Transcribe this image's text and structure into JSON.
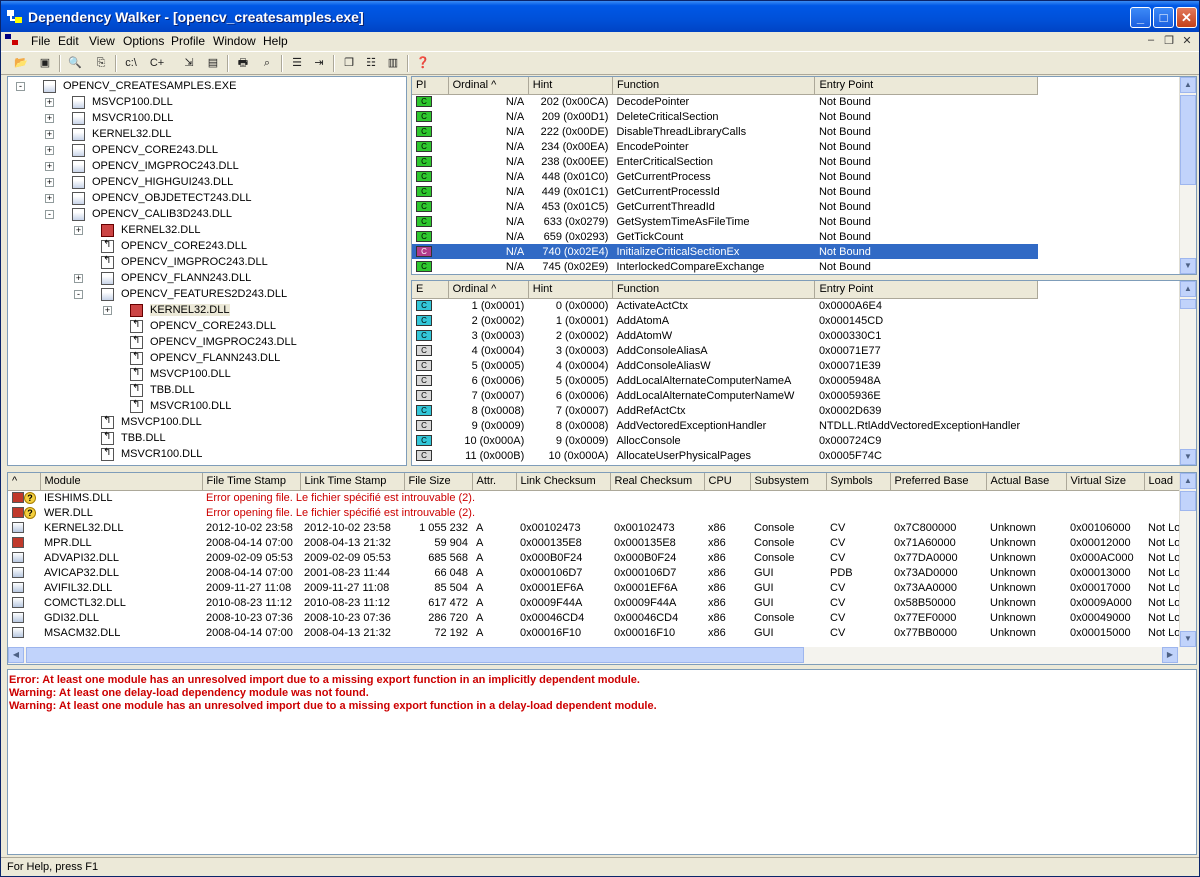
{
  "window": {
    "title": "Dependency Walker - [opencv_createsamples.exe]"
  },
  "menu": [
    "File",
    "Edit",
    "View",
    "Options",
    "Profile",
    "Window",
    "Help"
  ],
  "colors": {
    "titlebar": "#0054e3",
    "selection": "#316ac5",
    "error": "#cc0000",
    "import_ok": "#2ec72e",
    "export": "#33c7d9"
  },
  "tree": [
    {
      "label": "OPENCV_CREATESAMPLES.EXE",
      "depth": 0,
      "icon": "exe",
      "exp": "-"
    },
    {
      "label": "MSVCP100.DLL",
      "depth": 1,
      "icon": "dll",
      "exp": "+"
    },
    {
      "label": "MSVCR100.DLL",
      "depth": 1,
      "icon": "dll",
      "exp": "+"
    },
    {
      "label": "KERNEL32.DLL",
      "depth": 1,
      "icon": "dll",
      "exp": "+"
    },
    {
      "label": "OPENCV_CORE243.DLL",
      "depth": 1,
      "icon": "dll",
      "exp": "+"
    },
    {
      "label": "OPENCV_IMGPROC243.DLL",
      "depth": 1,
      "icon": "dll",
      "exp": "+"
    },
    {
      "label": "OPENCV_HIGHGUI243.DLL",
      "depth": 1,
      "icon": "dll",
      "exp": "+"
    },
    {
      "label": "OPENCV_OBJDETECT243.DLL",
      "depth": 1,
      "icon": "dll",
      "exp": "+"
    },
    {
      "label": "OPENCV_CALIB3D243.DLL",
      "depth": 1,
      "icon": "dll",
      "exp": "-"
    },
    {
      "label": "KERNEL32.DLL",
      "depth": 2,
      "icon": "red",
      "exp": "+"
    },
    {
      "label": "OPENCV_CORE243.DLL",
      "depth": 2,
      "icon": "arrow",
      "exp": ""
    },
    {
      "label": "OPENCV_IMGPROC243.DLL",
      "depth": 2,
      "icon": "arrow",
      "exp": ""
    },
    {
      "label": "OPENCV_FLANN243.DLL",
      "depth": 2,
      "icon": "dll",
      "exp": "+"
    },
    {
      "label": "OPENCV_FEATURES2D243.DLL",
      "depth": 2,
      "icon": "dll",
      "exp": "-"
    },
    {
      "label": "KERNEL32.DLL",
      "depth": 3,
      "icon": "red",
      "exp": "+",
      "sel": true
    },
    {
      "label": "OPENCV_CORE243.DLL",
      "depth": 3,
      "icon": "arrow",
      "exp": ""
    },
    {
      "label": "OPENCV_IMGPROC243.DLL",
      "depth": 3,
      "icon": "arrow",
      "exp": ""
    },
    {
      "label": "OPENCV_FLANN243.DLL",
      "depth": 3,
      "icon": "arrow",
      "exp": ""
    },
    {
      "label": "MSVCP100.DLL",
      "depth": 3,
      "icon": "arrow",
      "exp": ""
    },
    {
      "label": "TBB.DLL",
      "depth": 3,
      "icon": "arrow",
      "exp": ""
    },
    {
      "label": "MSVCR100.DLL",
      "depth": 3,
      "icon": "arrow",
      "exp": ""
    },
    {
      "label": "MSVCP100.DLL",
      "depth": 2,
      "icon": "arrow",
      "exp": ""
    },
    {
      "label": "TBB.DLL",
      "depth": 2,
      "icon": "arrow",
      "exp": ""
    },
    {
      "label": "MSVCR100.DLL",
      "depth": 2,
      "icon": "arrow",
      "exp": ""
    }
  ],
  "imports": {
    "headers": [
      "PI",
      "Ordinal ^",
      "Hint",
      "Function",
      "Entry Point"
    ],
    "rows": [
      [
        "g",
        "N/A",
        "202 (0x00CA)",
        "DecodePointer",
        "Not Bound"
      ],
      [
        "g",
        "N/A",
        "209 (0x00D1)",
        "DeleteCriticalSection",
        "Not Bound"
      ],
      [
        "g",
        "N/A",
        "222 (0x00DE)",
        "DisableThreadLibraryCalls",
        "Not Bound"
      ],
      [
        "g",
        "N/A",
        "234 (0x00EA)",
        "EncodePointer",
        "Not Bound"
      ],
      [
        "g",
        "N/A",
        "238 (0x00EE)",
        "EnterCriticalSection",
        "Not Bound"
      ],
      [
        "g",
        "N/A",
        "448 (0x01C0)",
        "GetCurrentProcess",
        "Not Bound"
      ],
      [
        "g",
        "N/A",
        "449 (0x01C1)",
        "GetCurrentProcessId",
        "Not Bound"
      ],
      [
        "g",
        "N/A",
        "453 (0x01C5)",
        "GetCurrentThreadId",
        "Not Bound"
      ],
      [
        "g",
        "N/A",
        "633 (0x0279)",
        "GetSystemTimeAsFileTime",
        "Not Bound"
      ],
      [
        "g",
        "N/A",
        "659 (0x0293)",
        "GetTickCount",
        "Not Bound"
      ],
      [
        "m",
        "N/A",
        "740 (0x02E4)",
        "InitializeCriticalSectionEx",
        "Not Bound"
      ],
      [
        "g",
        "N/A",
        "745 (0x02E9)",
        "InterlockedCompareExchange",
        "Not Bound"
      ]
    ],
    "selected": 10
  },
  "exports": {
    "headers": [
      "E",
      "Ordinal ^",
      "Hint",
      "Function",
      "Entry Point"
    ],
    "rows": [
      [
        "c",
        "1 (0x0001)",
        "0 (0x0000)",
        "ActivateActCtx",
        "0x0000A6E4"
      ],
      [
        "c",
        "2 (0x0002)",
        "1 (0x0001)",
        "AddAtomA",
        "0x000145CD"
      ],
      [
        "c",
        "3 (0x0003)",
        "2 (0x0002)",
        "AddAtomW",
        "0x000330C1"
      ],
      [
        "w",
        "4 (0x0004)",
        "3 (0x0003)",
        "AddConsoleAliasA",
        "0x00071E77"
      ],
      [
        "w",
        "5 (0x0005)",
        "4 (0x0004)",
        "AddConsoleAliasW",
        "0x00071E39"
      ],
      [
        "w",
        "6 (0x0006)",
        "5 (0x0005)",
        "AddLocalAlternateComputerNameA",
        "0x0005948A"
      ],
      [
        "w",
        "7 (0x0007)",
        "6 (0x0006)",
        "AddLocalAlternateComputerNameW",
        "0x0005936E"
      ],
      [
        "c",
        "8 (0x0008)",
        "7 (0x0007)",
        "AddRefActCtx",
        "0x0002D639"
      ],
      [
        "w",
        "9 (0x0009)",
        "8 (0x0008)",
        "AddVectoredExceptionHandler",
        "NTDLL.RtlAddVectoredExceptionHandler"
      ],
      [
        "c",
        "10 (0x000A)",
        "9 (0x0009)",
        "AllocConsole",
        "0x000724C9"
      ],
      [
        "w",
        "11 (0x000B)",
        "10 (0x000A)",
        "AllocateUserPhysicalPages",
        "0x0005F74C"
      ]
    ]
  },
  "modules": {
    "headers": [
      "^",
      "Module",
      "File Time Stamp",
      "Link Time Stamp",
      "File Size",
      "Attr.",
      "Link Checksum",
      "Real Checksum",
      "CPU",
      "Subsystem",
      "Symbols",
      "Preferred Base",
      "Actual Base",
      "Virtual Size",
      "Load"
    ],
    "rows": [
      {
        "icon": "q",
        "name": "IESHIMS.DLL",
        "error": "Error opening file. Le fichier spécifié est introuvable (2)."
      },
      {
        "icon": "q",
        "name": "WER.DLL",
        "error": "Error opening file. Le fichier spécifié est introuvable (2)."
      },
      {
        "icon": "dll",
        "name": "KERNEL32.DLL",
        "c": [
          "2012-10-02 23:58",
          "2012-10-02 23:58",
          "1 055 232",
          "A",
          "0x00102473",
          "0x00102473",
          "x86",
          "Console",
          "CV",
          "0x7C800000",
          "Unknown",
          "0x00106000",
          "Not Lo"
        ]
      },
      {
        "icon": "red",
        "name": "MPR.DLL",
        "c": [
          "2008-04-14 07:00",
          "2008-04-13 21:32",
          "59 904",
          "A",
          "0x000135E8",
          "0x000135E8",
          "x86",
          "Console",
          "CV",
          "0x71A60000",
          "Unknown",
          "0x00012000",
          "Not Lo"
        ]
      },
      {
        "icon": "dll",
        "name": "ADVAPI32.DLL",
        "c": [
          "2009-02-09 05:53",
          "2009-02-09 05:53",
          "685 568",
          "A",
          "0x000B0F24",
          "0x000B0F24",
          "x86",
          "Console",
          "CV",
          "0x77DA0000",
          "Unknown",
          "0x000AC000",
          "Not Lo"
        ]
      },
      {
        "icon": "dll",
        "name": "AVICAP32.DLL",
        "c": [
          "2008-04-14 07:00",
          "2001-08-23 11:44",
          "66 048",
          "A",
          "0x000106D7",
          "0x000106D7",
          "x86",
          "GUI",
          "PDB",
          "0x73AD0000",
          "Unknown",
          "0x00013000",
          "Not Lo"
        ]
      },
      {
        "icon": "dll",
        "name": "AVIFIL32.DLL",
        "c": [
          "2009-11-27 11:08",
          "2009-11-27 11:08",
          "85 504",
          "A",
          "0x0001EF6A",
          "0x0001EF6A",
          "x86",
          "GUI",
          "CV",
          "0x73AA0000",
          "Unknown",
          "0x00017000",
          "Not Lo"
        ]
      },
      {
        "icon": "dll",
        "name": "COMCTL32.DLL",
        "c": [
          "2010-08-23 11:12",
          "2010-08-23 11:12",
          "617 472",
          "A",
          "0x0009F44A",
          "0x0009F44A",
          "x86",
          "GUI",
          "CV",
          "0x58B50000",
          "Unknown",
          "0x0009A000",
          "Not Lo"
        ]
      },
      {
        "icon": "dll",
        "name": "GDI32.DLL",
        "c": [
          "2008-10-23 07:36",
          "2008-10-23 07:36",
          "286 720",
          "A",
          "0x00046CD4",
          "0x00046CD4",
          "x86",
          "Console",
          "CV",
          "0x77EF0000",
          "Unknown",
          "0x00049000",
          "Not Lo"
        ]
      },
      {
        "icon": "dll",
        "name": "MSACM32.DLL",
        "c": [
          "2008-04-14 07:00",
          "2008-04-13 21:32",
          "72 192",
          "A",
          "0x00016F10",
          "0x00016F10",
          "x86",
          "GUI",
          "CV",
          "0x77BB0000",
          "Unknown",
          "0x00015000",
          "Not Lo"
        ]
      }
    ]
  },
  "log": [
    "Error: At least one module has an unresolved import due to a missing export function in an implicitly dependent module.",
    "Warning: At least one delay-load dependency module was not found.",
    "Warning: At least one module has an unresolved import due to a missing export function in a delay-load dependent module."
  ],
  "status": "For Help, press F1"
}
